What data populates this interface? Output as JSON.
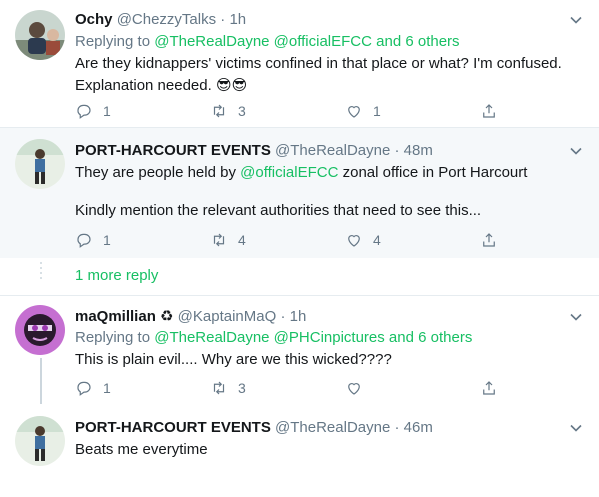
{
  "tweets": [
    {
      "name": "Ochy",
      "handle": "@ChezzyTalks",
      "time": "1h",
      "replying_prefix": "Replying to",
      "replying_mentions": "@TheRealDayne @officialEFCC and 6 others",
      "text_line1": "Are they kidnappers' victims confined in that place or what? I'm confused.",
      "text_line2": "Explanation needed. 😎😎",
      "replies": "1",
      "retweets": "3",
      "likes": "1"
    },
    {
      "name": "PORT-HARCOURT EVENTS",
      "handle": "@TheRealDayne",
      "time": "48m",
      "text_pre": "They are people held by ",
      "text_mention": "@officialEFCC",
      "text_post": " zonal office in Port Harcourt",
      "text_line2": "Kindly mention the relevant authorities that need to see this...",
      "replies": "1",
      "retweets": "4",
      "likes": "4"
    },
    {
      "more_replies": "1 more reply"
    },
    {
      "name": "maQmillian",
      "name_symbol": "♻",
      "handle": "@KaptainMaQ",
      "time": "1h",
      "replying_prefix": "Replying to",
      "replying_mentions": "@TheRealDayne @PHCinpictures and 6 others",
      "text_line1": "This is plain evil.... Why are we this wicked????",
      "replies": "1",
      "retweets": "3",
      "likes": ""
    },
    {
      "name": "PORT-HARCOURT EVENTS",
      "handle": "@TheRealDayne",
      "time": "46m",
      "text_line1": "Beats me everytime"
    }
  ],
  "separator": "·",
  "icons": [
    "chevron-down-icon",
    "reply-icon",
    "retweet-icon",
    "like-icon",
    "share-icon"
  ],
  "colors": {
    "link": "#17bf63",
    "meta": "#657786",
    "highlight_bg": "#f5f8fa"
  }
}
